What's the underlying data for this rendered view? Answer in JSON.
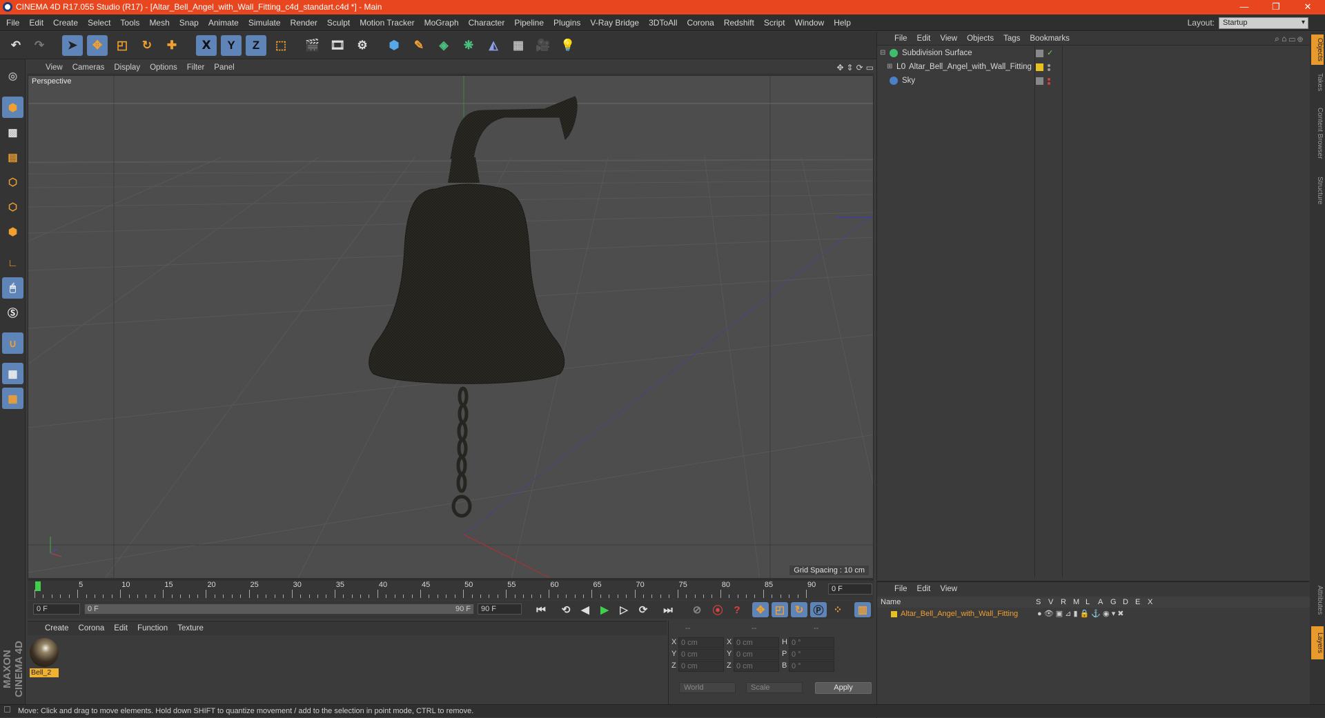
{
  "window": {
    "title": "CINEMA 4D R17.055 Studio (R17) - [Altar_Bell_Angel_with_Wall_Fitting_c4d_standart.c4d *] - Main",
    "minimize": "—",
    "maximize": "❐",
    "close": "✕"
  },
  "menubar": {
    "items": [
      "File",
      "Edit",
      "Create",
      "Select",
      "Tools",
      "Mesh",
      "Snap",
      "Animate",
      "Simulate",
      "Render",
      "Sculpt",
      "Motion Tracker",
      "MoGraph",
      "Character",
      "Pipeline",
      "Plugins",
      "V-Ray Bridge",
      "3DToAll",
      "Corona",
      "Redshift",
      "Script",
      "Window",
      "Help"
    ],
    "layout_label": "Layout:",
    "layout_value": "Startup"
  },
  "toolbar": {
    "axis_x": "X",
    "axis_y": "Y",
    "axis_z": "Z"
  },
  "viewport": {
    "menu": [
      "View",
      "Cameras",
      "Display",
      "Options",
      "Filter",
      "Panel"
    ],
    "label": "Perspective",
    "grid_spacing": "Grid Spacing : 10 cm",
    "axis_y": "y",
    "axis_x": "x",
    "axis_z": "z"
  },
  "object_manager": {
    "menu": [
      "File",
      "Edit",
      "View",
      "Objects",
      "Tags",
      "Bookmarks"
    ],
    "objects": [
      {
        "name": "Subdivision Surface",
        "icon_color": "#3fbf6a"
      },
      {
        "name": "Altar_Bell_Angel_with_Wall_Fitting",
        "icon_color": "#e0e0e0"
      },
      {
        "name": "Sky",
        "icon_color": "#4a80c8"
      }
    ]
  },
  "right_tabs": [
    "Objects",
    "Takes",
    "Content Browser",
    "Structure",
    "Attributes",
    "Layers"
  ],
  "timeline": {
    "ticks": [
      "0",
      "5",
      "10",
      "15",
      "20",
      "25",
      "30",
      "35",
      "40",
      "45",
      "50",
      "55",
      "60",
      "65",
      "70",
      "75",
      "80",
      "85",
      "90"
    ],
    "current_frame": "0 F",
    "start_field": "0 F",
    "range_start": "0 F",
    "range_end": "90 F",
    "end_field": "90 F"
  },
  "material_manager": {
    "menu": [
      "Create",
      "Corona",
      "Edit",
      "Function",
      "Texture"
    ],
    "material_name": "Bell_2"
  },
  "coordinates": {
    "header": [
      "--",
      "--",
      "--"
    ],
    "rows": [
      {
        "l1": "X",
        "v1": "0 cm",
        "l2": "X",
        "v2": "0 cm",
        "l3": "H",
        "v3": "0 °"
      },
      {
        "l1": "Y",
        "v1": "0 cm",
        "l2": "Y",
        "v2": "0 cm",
        "l3": "P",
        "v3": "0 °"
      },
      {
        "l1": "Z",
        "v1": "0 cm",
        "l2": "Z",
        "v2": "0 cm",
        "l3": "B",
        "v3": "0 °"
      }
    ],
    "world": "World",
    "scale": "Scale",
    "apply": "Apply"
  },
  "layer_manager": {
    "menu": [
      "File",
      "Edit",
      "View"
    ],
    "name_header": "Name",
    "column_headers": [
      "S",
      "V",
      "R",
      "M",
      "L",
      "A",
      "G",
      "D",
      "E",
      "X"
    ],
    "layer_name": "Altar_Bell_Angel_with_Wall_Fitting",
    "layer_color": "#e8c020"
  },
  "status": "Move: Click and drag to move elements. Hold down SHIFT to quantize movement / add to the selection in point mode, CTRL to remove.",
  "colors": {
    "title_bar": "#e8461f",
    "accent_blue": "#5f84b8",
    "accent_orange": "#f0a030"
  }
}
